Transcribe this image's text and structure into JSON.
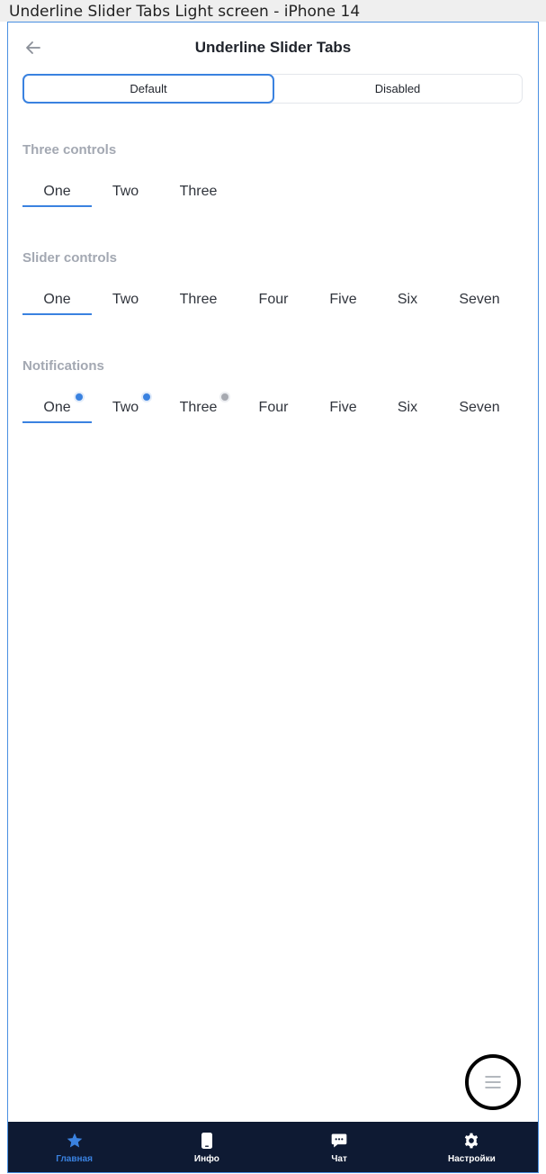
{
  "frame_title": "Underline Slider Tabs Light screen - iPhone 14",
  "header": {
    "title": "Underline Slider Tabs"
  },
  "segmented": {
    "items": [
      "Default",
      "Disabled"
    ],
    "selected": "Default"
  },
  "sections": [
    {
      "title": "Three controls",
      "tabs": [
        "One",
        "Two",
        "Three"
      ]
    },
    {
      "title": "Slider controls",
      "tabs": [
        "One",
        "Two",
        "Three",
        "Four",
        "Five",
        "Six",
        "Seven"
      ]
    },
    {
      "title": "Notifications",
      "tabs": [
        "One",
        "Two",
        "Three",
        "Four",
        "Five",
        "Six",
        "Seven"
      ]
    }
  ],
  "bottom_nav": {
    "items": [
      {
        "label": "Главная",
        "icon": "star-icon",
        "active": true
      },
      {
        "label": "Инфо",
        "icon": "phone-icon",
        "active": false
      },
      {
        "label": "Чат",
        "icon": "chat-icon",
        "active": false
      },
      {
        "label": "Настройки",
        "icon": "gear-icon",
        "active": false
      }
    ]
  },
  "colors": {
    "accent": "#3a82e0",
    "nav_bg": "#0e1a33",
    "section_title": "#a3a8b2",
    "notification_dot_inactive": "#a6a9b0"
  }
}
